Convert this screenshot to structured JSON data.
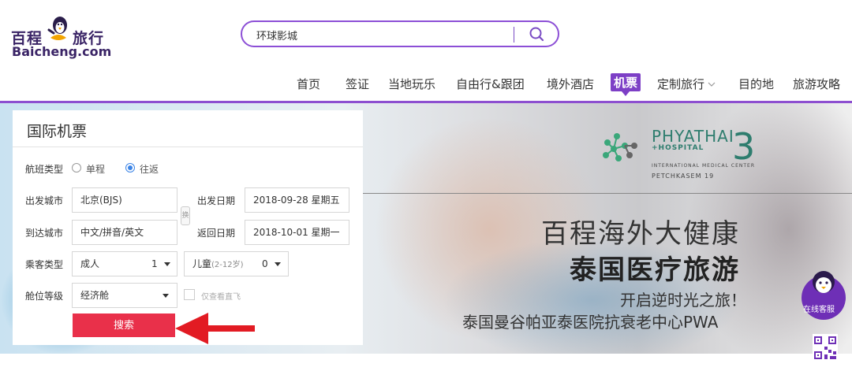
{
  "logo": {
    "cn_left": "百程",
    "cn_right": "旅行",
    "en": "Baicheng.com",
    "mascot_icon": "penguin-mascot-icon"
  },
  "search": {
    "value": "环球影城",
    "button_icon": "search-icon"
  },
  "nav": {
    "items": [
      "首页",
      "签证",
      "当地玩乐",
      "自由行&跟团",
      "境外酒店",
      "机票",
      "定制旅行",
      "目的地",
      "旅游攻略"
    ],
    "active": "机票",
    "dropdown_icon": "chevron-down-icon"
  },
  "colors": {
    "brand_purple": "#7d3fc6",
    "search_red": "#e9304a",
    "radio_blue": "#3b84e6",
    "hospital_green": "#2e7d6e"
  },
  "banner": {
    "hospital": {
      "name": "PHYATHAI",
      "sub": "HOSPITAL",
      "number": "3",
      "line1": "INTERNATIONAL MEDICAL CENTER",
      "line2": "PETCHKASEM 19"
    },
    "title": "百程海外大健康",
    "title_bold": "泰国医疗旅游",
    "subtitle1": "开启逆时光之旅！",
    "subtitle2": "泰国曼谷帕亚泰医院抗衰老中心PWA"
  },
  "flight_form": {
    "title": "国际机票",
    "trip_type_label": "航班类型",
    "trip_options": [
      "单程",
      "往返"
    ],
    "trip_selected": "往返",
    "from_label": "出发城市",
    "from_value": "北京(BJS)",
    "swap_label": "换",
    "depart_label": "出发日期",
    "depart_value": "2018-09-28 星期五",
    "to_label": "到达城市",
    "to_placeholder": "中文/拼音/英文",
    "return_label": "返回日期",
    "return_value": "2018-10-01 星期一",
    "passenger_label": "乘客类型",
    "adult_label": "成人",
    "adult_count": "1",
    "child_label": "儿童",
    "child_age": "(2-12岁)",
    "child_count": "0",
    "cabin_label": "舱位等级",
    "cabin_value": "经济舱",
    "direct_only_label": "仅查看直飞",
    "search_button": "搜索"
  },
  "floating": {
    "customer_service": "在线客服",
    "qr_icon": "qr-code-icon"
  }
}
